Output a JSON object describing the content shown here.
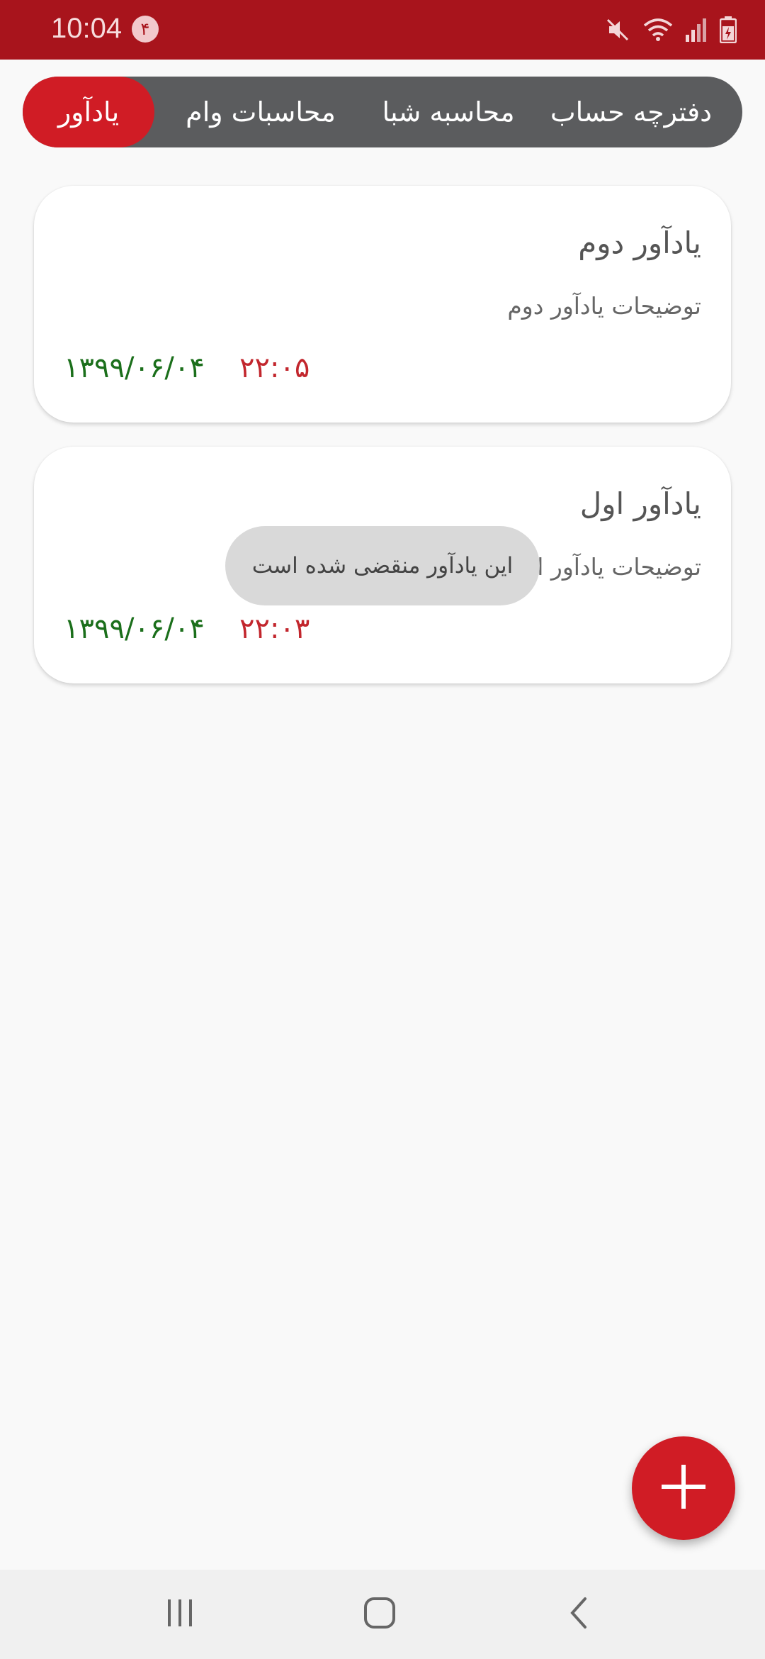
{
  "status_bar": {
    "time": "10:04",
    "notification_count": "۴",
    "icons": [
      "mute-icon",
      "wifi-icon",
      "signal-icon",
      "battery-icon"
    ]
  },
  "tabs": [
    {
      "label": "دفترچه حساب",
      "active": false
    },
    {
      "label": "محاسبه شبا",
      "active": false
    },
    {
      "label": "محاسبات وام",
      "active": false
    },
    {
      "label": "یادآور",
      "active": true
    }
  ],
  "reminders": [
    {
      "title": "یادآور دوم",
      "description": "توضیحات یادآور دوم",
      "time": "۲۲:۰۵",
      "date": "۱۳۹۹/۰۶/۰۴"
    },
    {
      "title": "یادآور اول",
      "description": "توضیحات یادآور اول",
      "time": "۲۲:۰۳",
      "date": "۱۳۹۹/۰۶/۰۴"
    }
  ],
  "toast": {
    "message": "این یادآور منقضی شده است"
  },
  "fab": {
    "icon": "plus-icon"
  },
  "nav_bar": {
    "buttons": [
      "recents-icon",
      "home-icon",
      "back-icon"
    ]
  },
  "colors": {
    "primary": "#d01c25",
    "status_bar": "#a8141c",
    "tab_bar": "#5b5c5e",
    "date": "#1b6f1b",
    "time": "#c2262d"
  }
}
